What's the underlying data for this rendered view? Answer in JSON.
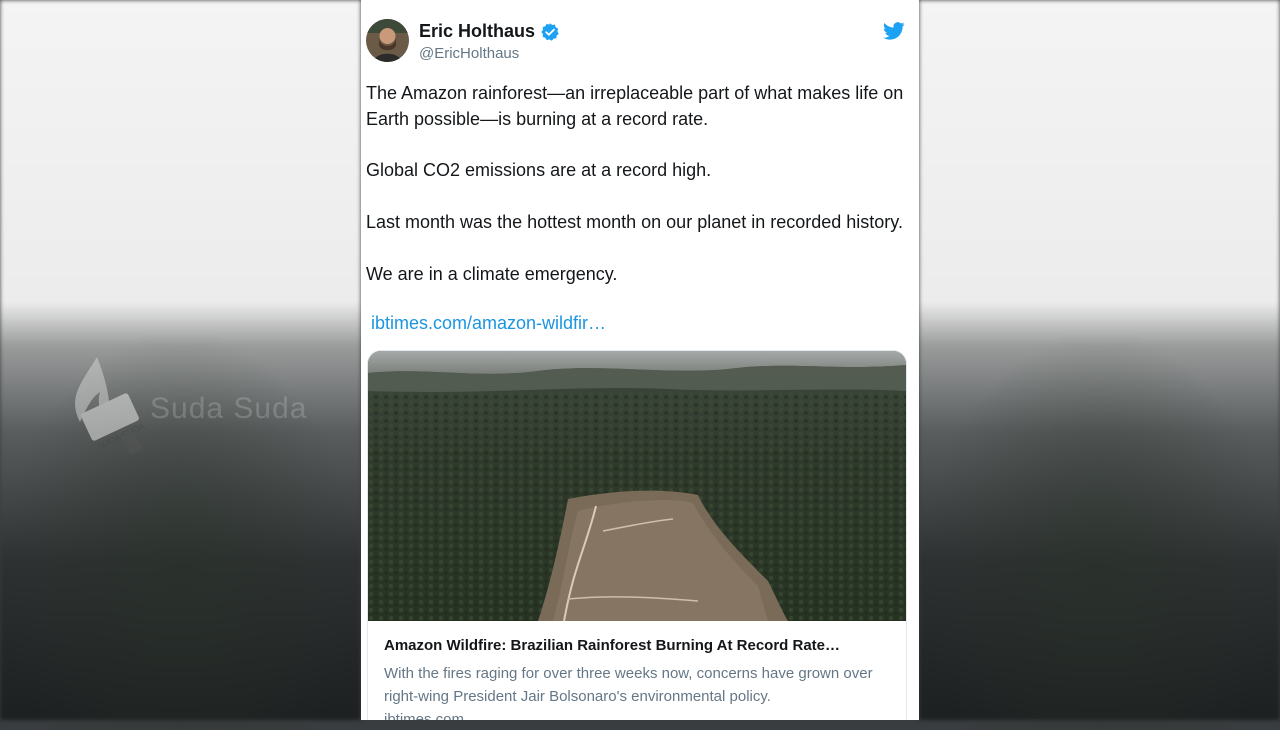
{
  "tweet": {
    "author_name": "Eric Holthaus",
    "handle": "@EricHolthaus",
    "verified_icon": "verified-badge-icon",
    "platform_icon": "twitter-bird-icon",
    "paragraphs": [
      "The Amazon rainforest—an irreplaceable part of what makes life on Earth possible—is burning at a record rate.",
      "Global CO2 emissions are at a record high.",
      "Last month was the hottest month on our planet in recorded history.",
      "We are in a climate emergency."
    ],
    "link_text": "ibtimes.com/amazon-wildfir…"
  },
  "preview": {
    "title": "Amazon Wildfire: Brazilian Rainforest Burning At Record Rate…",
    "description": "With the fires raging for over three weeks now, concerns have grown over right-wing President Jair Bolsonaro's environmental policy.",
    "domain": "ibtimes.com"
  },
  "watermark": {
    "badge_text": "SUDA SUDA",
    "text": "Suda Suda"
  },
  "colors": {
    "link": "#1b95e0",
    "verified": "#1da1f2",
    "twitter_blue": "#1da1f2"
  }
}
